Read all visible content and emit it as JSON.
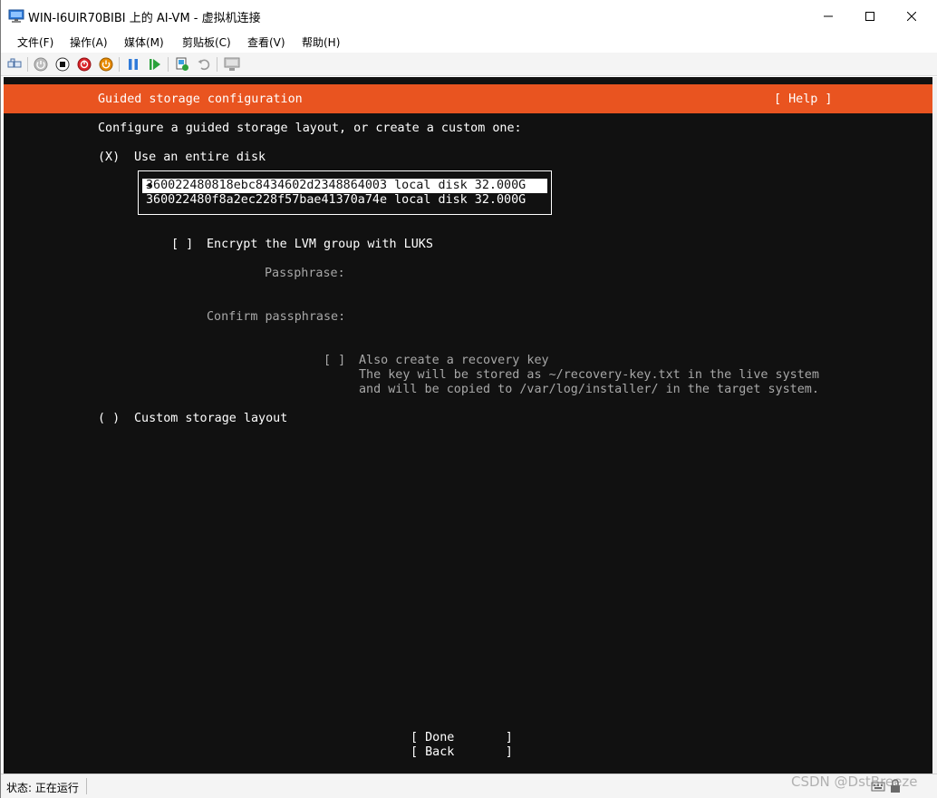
{
  "window": {
    "title": "WIN-I6UIR70BIBI 上的 AI-VM - 虚拟机连接",
    "icons": {
      "app": "vm-connection-icon",
      "minimize": "minimize-icon",
      "maximize": "maximize-icon",
      "close": "close-icon"
    }
  },
  "menubar": {
    "items": [
      "文件(F)",
      "操作(A)",
      "媒体(M)",
      "剪贴板(C)",
      "查看(V)",
      "帮助(H)"
    ]
  },
  "toolbar": {
    "buttons": [
      "ctrl-alt-del-icon",
      "start-icon",
      "turn-off-icon",
      "shutdown-icon",
      "save-icon",
      "pause-icon",
      "resume-icon",
      "checkpoint-icon",
      "revert-icon",
      "enhanced-session-icon"
    ],
    "colors": {
      "red": "#d9252a",
      "orange": "#e88a00",
      "blue": "#2f7ad9",
      "green": "#2aa13a"
    }
  },
  "installer": {
    "accent": "#e95420",
    "header_title": "Guided storage configuration",
    "help_button": "[ Help ]",
    "intro": "Configure a guided storage layout, or create a custom one:",
    "use_entire_disk_radio": "(X)",
    "use_entire_disk_label": "Use an entire disk",
    "disks": [
      "360022480818ebc8434602d2348864003 local disk 32.000G",
      "360022480f8a2ec228f57bae41370a74e local disk 32.000G"
    ],
    "disk_selected_marker": "◀",
    "encrypt_checkbox": "[ ]",
    "encrypt_label": "Encrypt the LVM group with LUKS",
    "passphrase_label": "Passphrase:",
    "confirm_passphrase_label": "Confirm passphrase:",
    "recovery_checkbox": "[ ]",
    "recovery_label": "Also create a recovery key",
    "recovery_note_1": "The key will be stored as ~/recovery-key.txt in the live system",
    "recovery_note_2": "and will be copied to /var/log/installer/ in the target system.",
    "custom_radio": "( )",
    "custom_label": "Custom storage layout",
    "done_button": "[ Done       ]",
    "back_button": "[ Back       ]"
  },
  "statusbar": {
    "status": "状态: 正在运行",
    "icons": [
      "keyboard-icon",
      "lock-icon"
    ]
  },
  "watermark": "CSDN @DstBreeze"
}
